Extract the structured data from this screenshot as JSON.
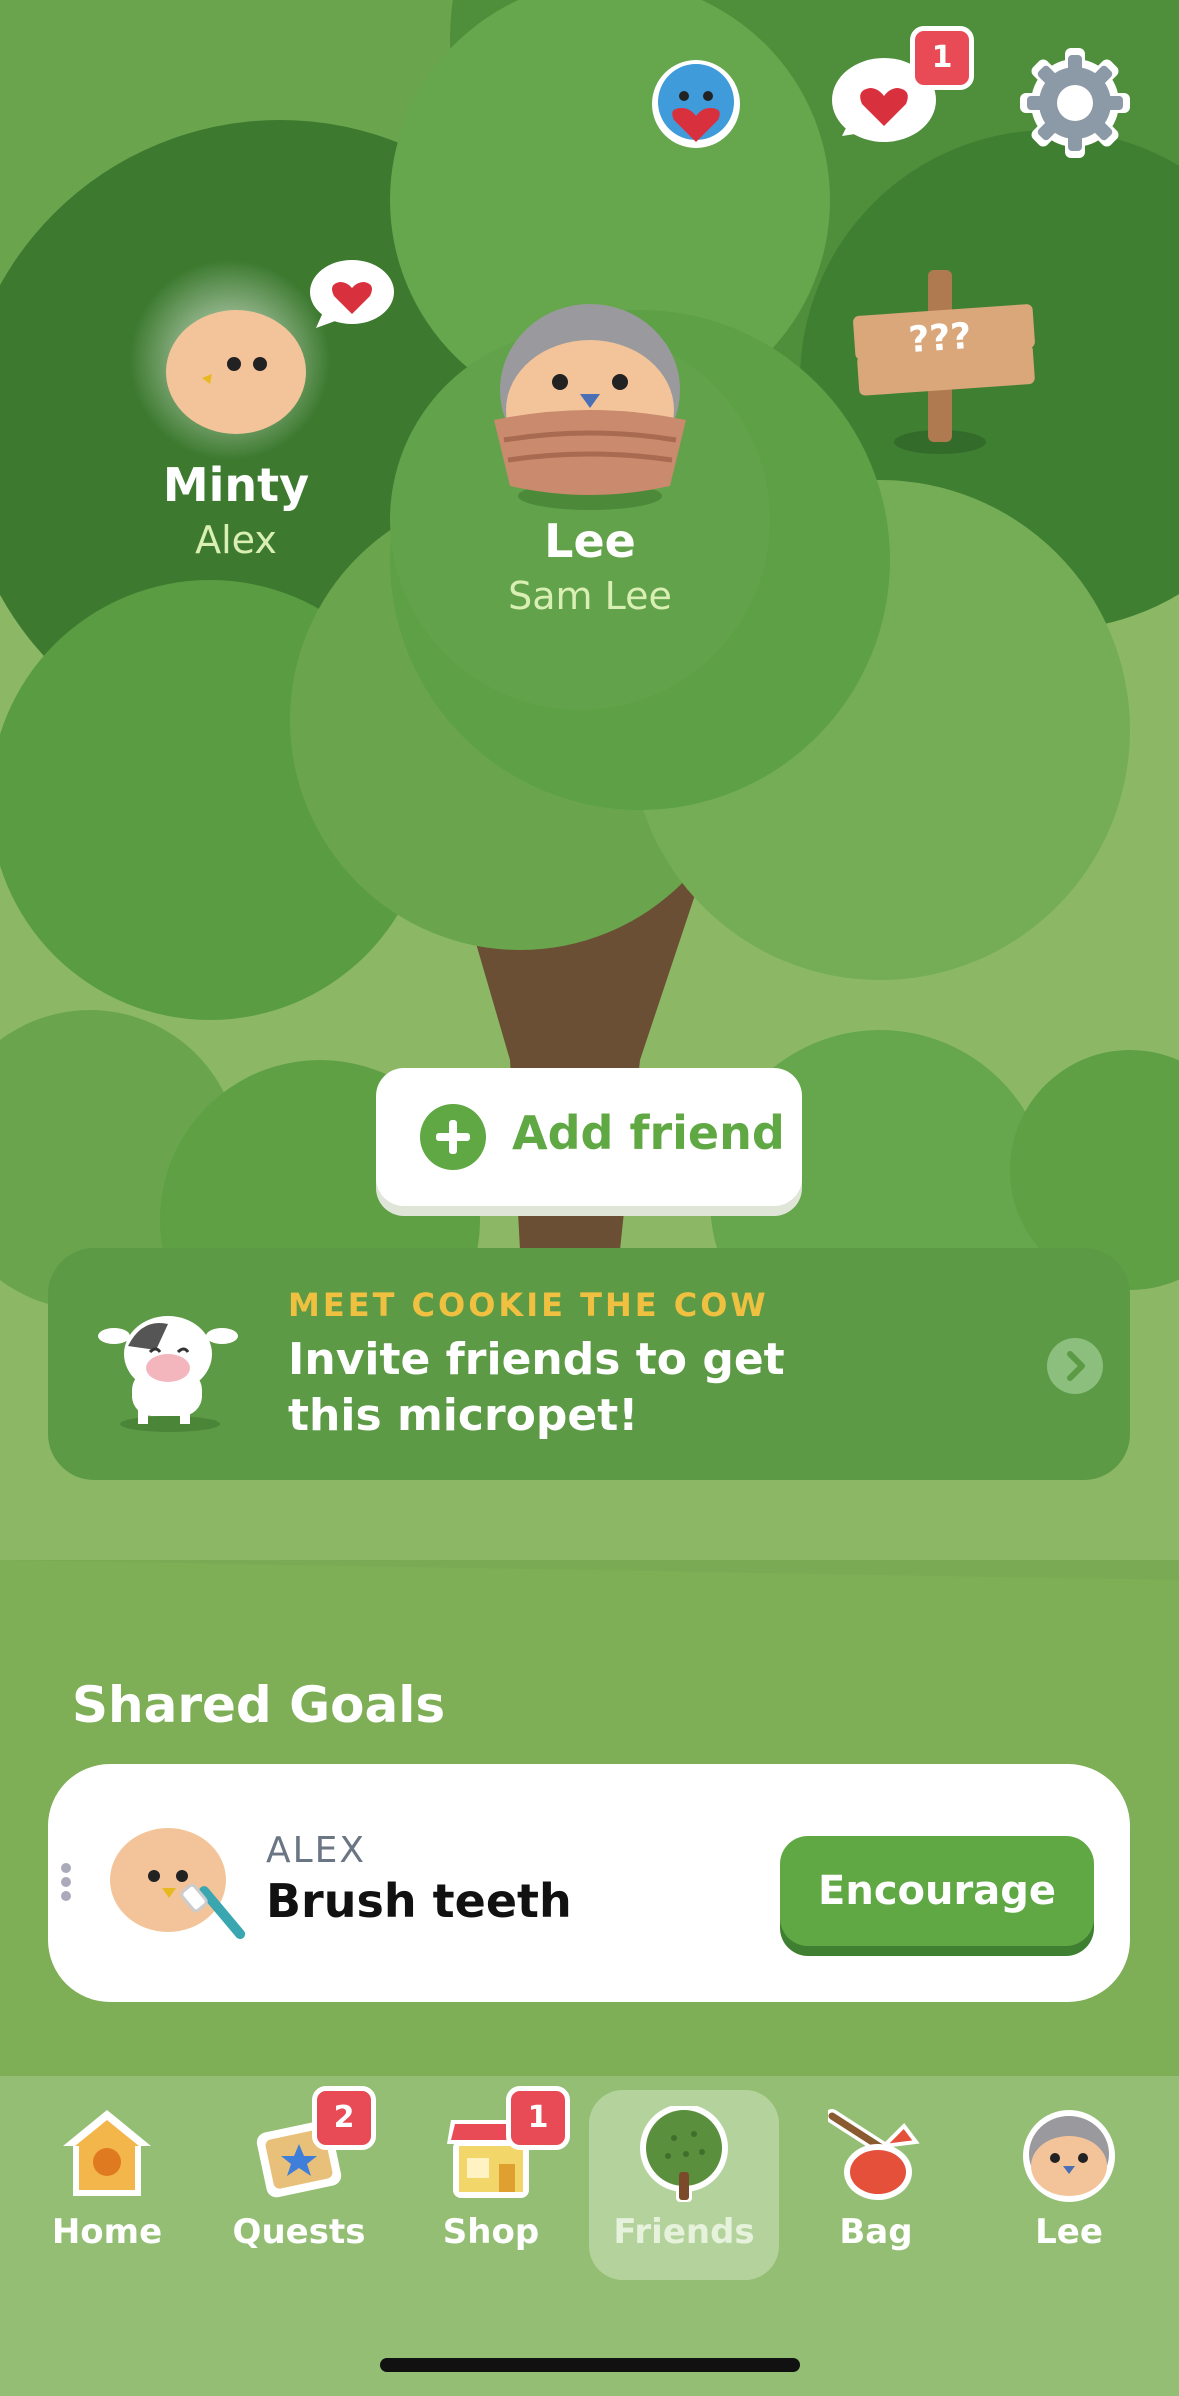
{
  "header": {
    "notification_count": "1",
    "icons": [
      "bird-heart-icon",
      "heart-chat-icon",
      "gear-icon"
    ]
  },
  "tree_friends": [
    {
      "pet_name": "Minty",
      "owner": "Alex"
    },
    {
      "pet_name": "Lee",
      "owner": "Sam Lee"
    }
  ],
  "signpost": {
    "text": "???"
  },
  "add_friend": {
    "label": "Add friend"
  },
  "promo": {
    "eyebrow": "MEET COOKIE THE COW",
    "text": "Invite friends to get this micropet!"
  },
  "shared_goals": {
    "title": "Shared Goals",
    "items": [
      {
        "who": "ALEX",
        "goal": "Brush teeth",
        "action": "Encourage"
      }
    ]
  },
  "tabbar": {
    "items": [
      {
        "label": "Home",
        "badge": ""
      },
      {
        "label": "Quests",
        "badge": "2"
      },
      {
        "label": "Shop",
        "badge": "1"
      },
      {
        "label": "Friends",
        "badge": ""
      },
      {
        "label": "Bag",
        "badge": ""
      },
      {
        "label": "Lee",
        "badge": ""
      }
    ],
    "active": "Friends"
  },
  "colors": {
    "accent_green": "#5fa844",
    "eyebrow_yellow": "#f0c040",
    "badge_red": "#e84a56",
    "sky_navy": "#2b2f7a"
  }
}
